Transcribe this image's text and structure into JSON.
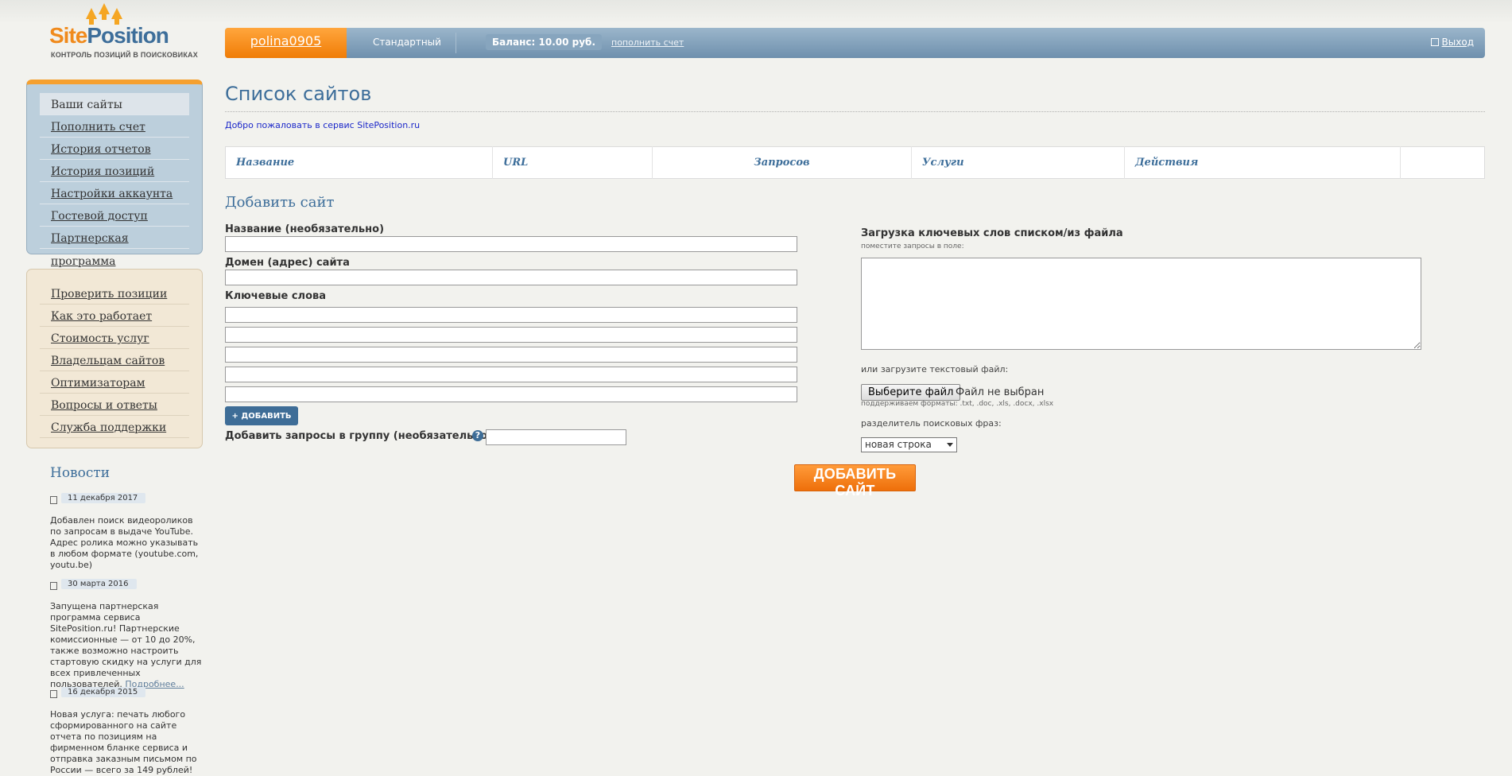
{
  "brand": {
    "name_part1": "Site",
    "name_part2": "Position",
    "tagline": "КОНТРОЛЬ ПОЗИЦИЙ В ПОИСКОВИКАХ",
    "color_orange": "#f08a1c",
    "color_blue": "#3d6e9a"
  },
  "topbar": {
    "username": "polina0905",
    "plan": "Стандартный",
    "balance": "Баланс: 10.00 руб.",
    "topup_link": "пополнить счет",
    "logout": "Выход"
  },
  "sidebar": {
    "menu_main": [
      "Ваши сайты",
      "Пополнить счет",
      "История отчетов",
      "История позиций",
      "Настройки аккаунта",
      "Гостевой доступ",
      "Партнерская программа"
    ],
    "menu_info": [
      "Проверить позиции",
      "Как это работает",
      "Стоимость услуг",
      "Владельцам сайтов",
      "Оптимизаторам",
      "Вопросы и ответы",
      "Служба поддержки"
    ]
  },
  "news": {
    "title": "Новости",
    "items": [
      {
        "date": "11 декабря 2017",
        "text": "Добавлен поиск видеороликов по запросам в выдаче YouTube. Адрес ролика можно указывать в любом формате (youtube.com, youtu.be)"
      },
      {
        "date": "30 марта 2016",
        "text": "Запущена партнерская программа сервиса SitePosition.ru! Партнерские комиссионные — от 10 до 20%, также возможно настроить стартовую скидку на услуги для всех привлеченных пользователей.",
        "more": "Подробнее..."
      },
      {
        "date": "16 декабря 2015",
        "text": "Новая услуга: печать любого сформированного на сайте отчета по позициям на фирменном бланке сервиса и отправка заказным письмом по России — всего за 149 рублей!"
      }
    ]
  },
  "main": {
    "title": "Список сайтов",
    "welcome": "Добро пожаловать в сервис SitePosition.ru",
    "table_headers": [
      "Название",
      "URL",
      "Запросов",
      "Услуги",
      "Действия",
      ""
    ]
  },
  "form": {
    "title": "Добавить сайт",
    "name_label": "Название (необязательно)",
    "domain_label": "Домен (адрес) сайта",
    "keywords_label": "Ключевые слова",
    "add_button": "+ ДОБАВИТЬ",
    "group_label": "Добавить запросы в группу (необязательно):",
    "bulk_title": "Загрузка ключевых слов списком/из файла",
    "bulk_hint": "поместите запросы в поле:",
    "file_prompt": "или загрузите текстовый файл:",
    "file_button": "Выберите файл",
    "file_status": "Файл не выбран",
    "formats": "поддерживаем форматы: .txt, .doc, .xls, .docx, .xlsx",
    "separator_label": "разделитель поисковых фраз:",
    "separator_value": "новая строка",
    "submit": "ДОБАВИТЬ САЙТ"
  }
}
